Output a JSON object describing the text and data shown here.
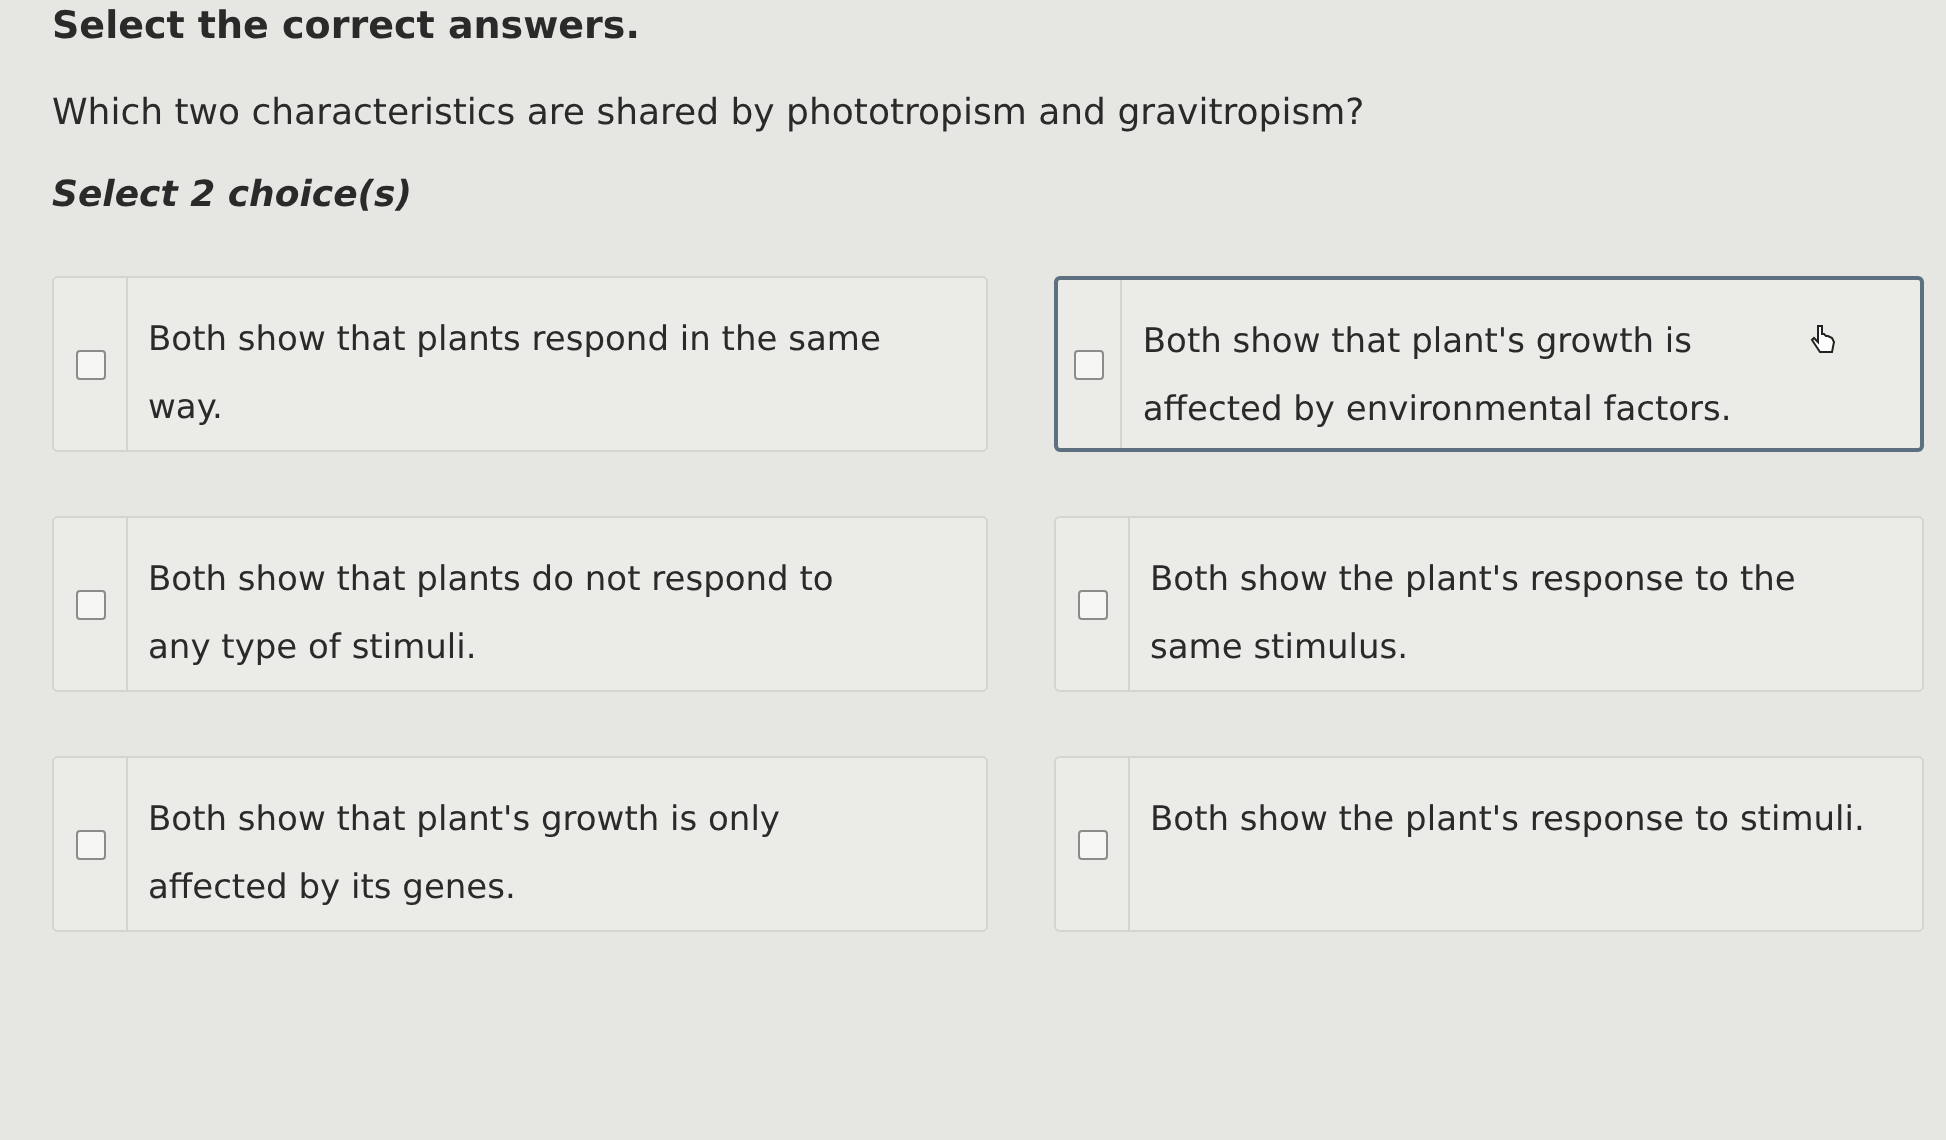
{
  "heading": "Select the correct answers.",
  "question": "Which two characteristics are shared by phototropism and gravitropism?",
  "instruction": "Select 2 choice(s)",
  "choices": [
    {
      "text": "Both show that plants respond in the same way.",
      "checked": false,
      "hovered": false
    },
    {
      "text": "Both show that plant's growth is affected by environmental factors.",
      "checked": false,
      "hovered": true
    },
    {
      "text": "Both show that plants do not respond to any type of stimuli.",
      "checked": false,
      "hovered": false
    },
    {
      "text": "Both show the plant's response to the same stimulus.",
      "checked": false,
      "hovered": false
    },
    {
      "text": "Both show that plant's growth is only affected by its genes.",
      "checked": false,
      "hovered": false
    },
    {
      "text": "Both show the plant's response to stimuli.",
      "checked": false,
      "hovered": false
    }
  ]
}
